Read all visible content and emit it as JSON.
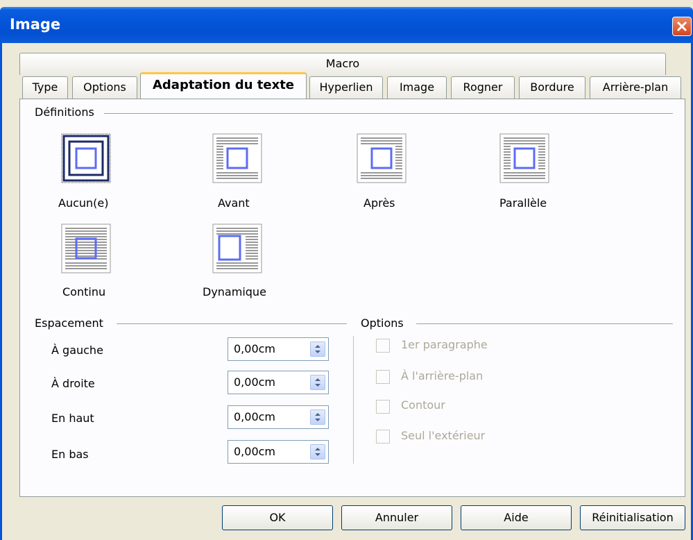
{
  "window": {
    "title": "Image"
  },
  "tabs": {
    "row1": [
      "Macro"
    ],
    "row2": [
      "Type",
      "Options",
      "Adaptation du texte",
      "Hyperlien",
      "Image",
      "Rogner",
      "Bordure",
      "Arrière-plan"
    ],
    "active": "Adaptation du texte"
  },
  "definitions": {
    "title": "Définitions",
    "options": [
      {
        "label": "Aucun(e)",
        "selected": true
      },
      {
        "label": "Avant",
        "selected": false
      },
      {
        "label": "Après",
        "selected": false
      },
      {
        "label": "Parallèle",
        "selected": false
      },
      {
        "label": "Continu",
        "selected": false
      },
      {
        "label": "Dynamique",
        "selected": false
      }
    ]
  },
  "spacing": {
    "title": "Espacement",
    "fields": [
      {
        "label": "À gauche",
        "value": "0,00cm"
      },
      {
        "label": "À droite",
        "value": "0,00cm"
      },
      {
        "label": "En haut",
        "value": "0,00cm"
      },
      {
        "label": "En bas",
        "value": "0,00cm"
      }
    ]
  },
  "options": {
    "title": "Options",
    "checkboxes": [
      {
        "label": "1er paragraphe",
        "checked": false,
        "enabled": false
      },
      {
        "label": "À l'arrière-plan",
        "checked": false,
        "enabled": false
      },
      {
        "label": "Contour",
        "checked": false,
        "enabled": false
      },
      {
        "label": "Seul l'extérieur",
        "checked": false,
        "enabled": false
      }
    ]
  },
  "buttons": {
    "ok": "OK",
    "cancel": "Annuler",
    "help": "Aide",
    "reset": "Réinitialisation"
  },
  "colors": {
    "titlebar": "#0454d8",
    "accent": "#ffc83c",
    "panel": "#fcfcfe",
    "dialog": "#ece9d8",
    "icon_frame": "#5c6cf4"
  }
}
